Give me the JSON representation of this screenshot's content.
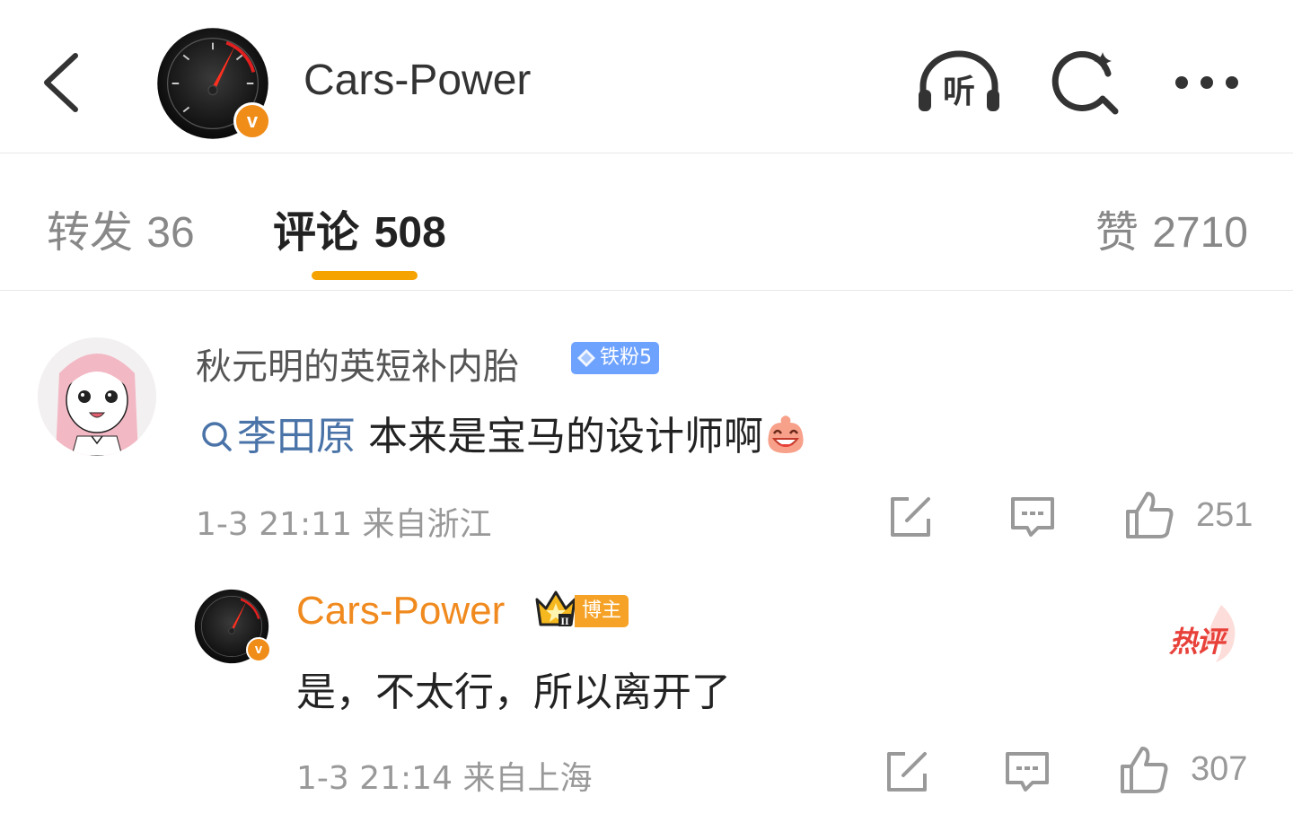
{
  "header": {
    "title": "Cars-Power",
    "avatar_badge": "v",
    "listen_label": "听"
  },
  "tabs": {
    "repost": {
      "label": "转发",
      "count": "36"
    },
    "comments": {
      "label": "评论",
      "count": "508"
    },
    "likes": {
      "label": "赞",
      "count": "2710"
    },
    "active": "comments",
    "accent_color": "#f5a300"
  },
  "comments": [
    {
      "username": "秋元明的英短补内胎",
      "fan_badge": "铁粉5",
      "mention": "李田原",
      "text": "本来是宝马的设计师啊",
      "emoji": "laughing-face-emoji",
      "timestamp": "1-3 21:11",
      "location": "来自浙江",
      "likes": "251"
    },
    {
      "username": "Cars-Power",
      "role_badge": "博主",
      "crown_level": "II",
      "hot_badge": "热评",
      "avatar_badge": "v",
      "text": "是，不太行，所以离开了",
      "timestamp": "1-3 21:14",
      "location": "来自上海",
      "likes": "307"
    }
  ],
  "colors": {
    "blogger_name": "#f08a1e",
    "mention": "#4a73a8",
    "fan_badge": "#6ea2ff",
    "hot": "#e8413a"
  }
}
